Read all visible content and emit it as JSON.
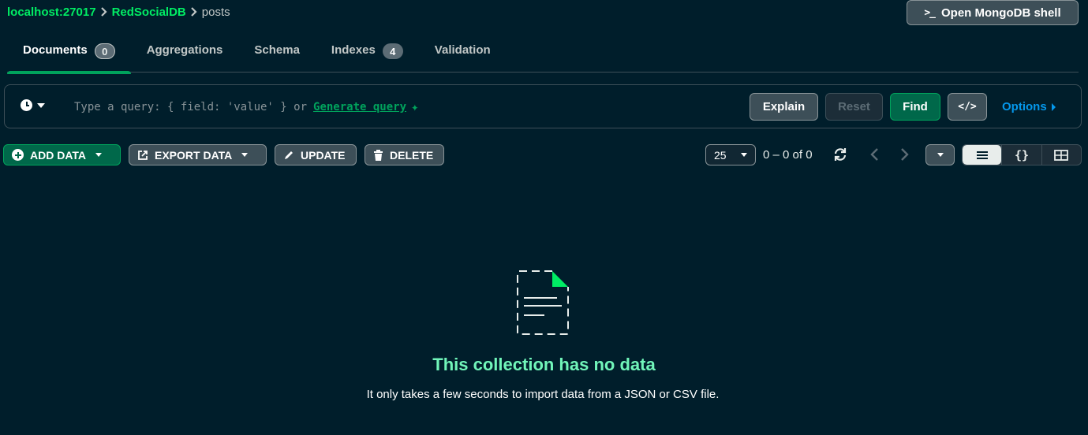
{
  "breadcrumb": {
    "host": "localhost:27017",
    "database": "RedSocialDB",
    "collection": "posts"
  },
  "shell_button": {
    "label": "Open MongoDB shell",
    "icon": "terminal-icon"
  },
  "tabs": [
    {
      "label": "Documents",
      "count": "0",
      "active": true
    },
    {
      "label": "Aggregations"
    },
    {
      "label": "Schema"
    },
    {
      "label": "Indexes",
      "count": "4"
    },
    {
      "label": "Validation"
    }
  ],
  "query": {
    "placeholder": "Type a query: { field: 'value' } or",
    "generate_link": "Generate query",
    "buttons": {
      "explain": "Explain",
      "reset": "Reset",
      "find": "Find",
      "code": "</>"
    },
    "options": "Options"
  },
  "toolbar": {
    "add_data": "ADD DATA",
    "export_data": "EXPORT DATA",
    "update": "UPDATE",
    "delete": "DELETE",
    "page_size": "25",
    "page_range": "0 – 0 of 0"
  },
  "empty_state": {
    "title": "This collection has no data",
    "description": "It only takes a few seconds to import data from a JSON or CSV file."
  },
  "colors": {
    "background": "#001e2b",
    "accent_green": "#00ed64",
    "button_green": "#00684a",
    "link_blue": "#0498ec",
    "empty_title": "#71f6ba"
  }
}
